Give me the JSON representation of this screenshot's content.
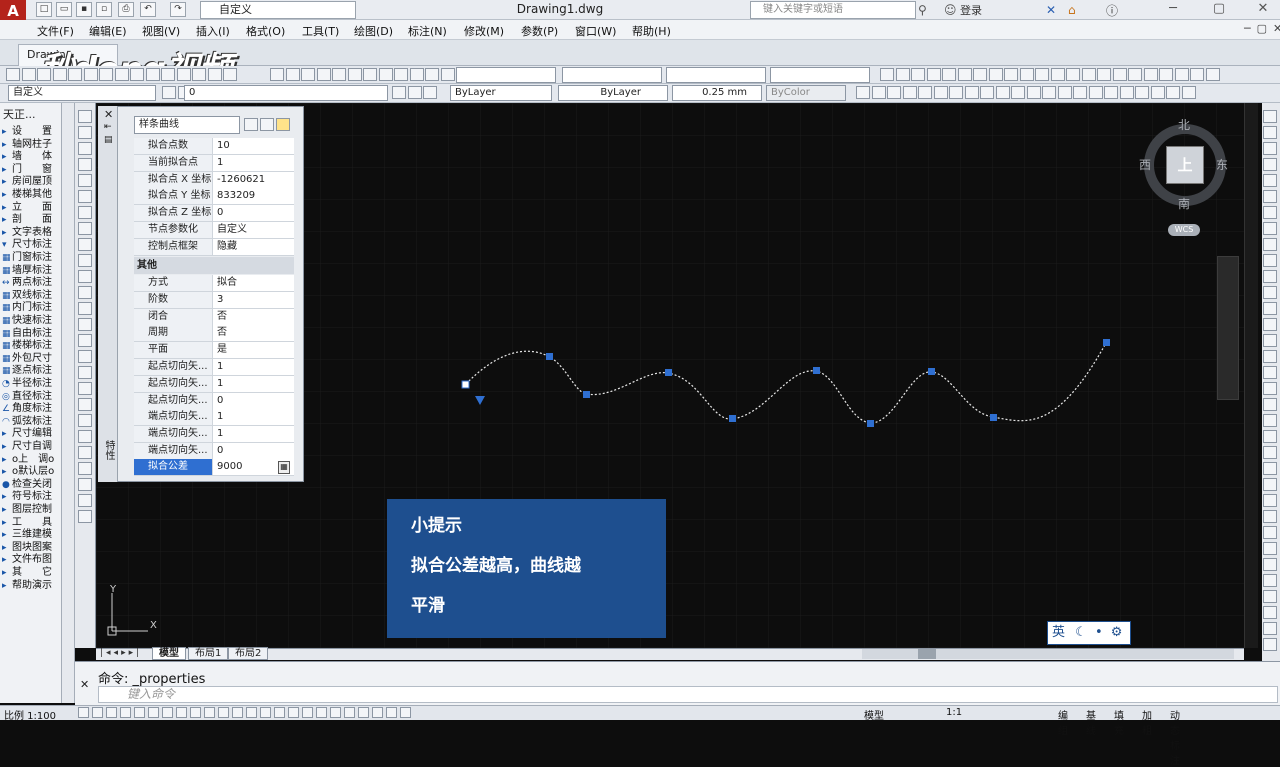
{
  "titlebar": {
    "app_logo": "A",
    "workspace": "自定义",
    "document_title": "Drawing1.dwg",
    "search_placeholder": "键入关键字或短语",
    "login": "登录",
    "win_minimize": "─",
    "win_restore": "▢",
    "win_close": "✕"
  },
  "menu": [
    "文件(F)",
    "编辑(E)",
    "视图(V)",
    "插入(I)",
    "格式(O)",
    "工具(T)",
    "绘图(D)",
    "标注(N)",
    "修改(M)",
    "参数(P)",
    "窗口(W)",
    "帮助(H)"
  ],
  "tabs": {
    "drawing_tab": "Drawing"
  },
  "watermark": "秒dong视频",
  "toolbar": {
    "workspace_select": "自定义",
    "layer_select": "0",
    "color_select": "ByLayer",
    "linetype_select": "ByLayer",
    "lineweight_select": "0.25 mm",
    "plotstyle_select": "ByColor"
  },
  "left_panel": {
    "title": "天正...",
    "items": [
      {
        "glyph": "▸",
        "label": "设　　置"
      },
      {
        "glyph": "▸",
        "label": "轴网柱子"
      },
      {
        "glyph": "▸",
        "label": "墙　　体"
      },
      {
        "glyph": "▸",
        "label": "门　　窗"
      },
      {
        "glyph": "▸",
        "label": "房间屋顶"
      },
      {
        "glyph": "▸",
        "label": "楼梯其他"
      },
      {
        "glyph": "▸",
        "label": "立　　面"
      },
      {
        "glyph": "▸",
        "label": "剖　　面"
      },
      {
        "glyph": "▸",
        "label": "文字表格"
      },
      {
        "glyph": "▾",
        "label": "尺寸标注"
      },
      {
        "glyph": "▦",
        "label": "门窗标注"
      },
      {
        "glyph": "▦",
        "label": "墙厚标注"
      },
      {
        "glyph": "↔",
        "label": "两点标注"
      },
      {
        "glyph": "▦",
        "label": "双线标注"
      },
      {
        "glyph": "▦",
        "label": "内门标注"
      },
      {
        "glyph": "▦",
        "label": "快速标注"
      },
      {
        "glyph": "▦",
        "label": "自由标注"
      },
      {
        "glyph": "▦",
        "label": "楼梯标注"
      },
      {
        "glyph": "▦",
        "label": "外包尺寸"
      },
      {
        "glyph": "▦",
        "label": "逐点标注"
      },
      {
        "glyph": "◔",
        "label": "半径标注"
      },
      {
        "glyph": "◎",
        "label": "直径标注"
      },
      {
        "glyph": "∠",
        "label": "角度标注"
      },
      {
        "glyph": "◠",
        "label": "弧弦标注"
      },
      {
        "glyph": "▸",
        "label": "尺寸编辑"
      },
      {
        "glyph": "▸",
        "label": "尺寸自调"
      },
      {
        "glyph": "▸",
        "label": "o上　调o"
      },
      {
        "glyph": "▸",
        "label": "o默认层o"
      },
      {
        "glyph": "●",
        "label": "检查关闭"
      },
      {
        "glyph": "▸",
        "label": "符号标注"
      },
      {
        "glyph": "▸",
        "label": "图层控制"
      },
      {
        "glyph": "▸",
        "label": "工　　具"
      },
      {
        "glyph": "▸",
        "label": "三维建模"
      },
      {
        "glyph": "▸",
        "label": "图块图案"
      },
      {
        "glyph": "▸",
        "label": "文件布图"
      },
      {
        "glyph": "▸",
        "label": "其　　它"
      },
      {
        "glyph": "▸",
        "label": "帮助演示"
      }
    ]
  },
  "properties": {
    "object_type": "样条曲线",
    "strip_label": "特性",
    "rows_top": [
      {
        "key": "拟合点数",
        "value": "10"
      },
      {
        "key": "当前拟合点",
        "value": "1"
      },
      {
        "key": "拟合点 X 坐标",
        "value": "-1260621"
      },
      {
        "key": "拟合点 Y 坐标",
        "value": "833209"
      },
      {
        "key": "拟合点 Z 坐标",
        "value": "0"
      },
      {
        "key": "节点参数化",
        "value": "自定义"
      },
      {
        "key": "控制点框架",
        "value": "隐藏"
      }
    ],
    "section_other": "其他",
    "rows_other": [
      {
        "key": "方式",
        "value": "拟合"
      },
      {
        "key": "阶数",
        "value": "3"
      },
      {
        "key": "闭合",
        "value": "否"
      },
      {
        "key": "周期",
        "value": "否"
      },
      {
        "key": "平面",
        "value": "是"
      },
      {
        "key": "起点切向矢...",
        "value": "1"
      },
      {
        "key": "起点切向矢...",
        "value": "1"
      },
      {
        "key": "起点切向矢...",
        "value": "0"
      },
      {
        "key": "端点切向矢...",
        "value": "1"
      },
      {
        "key": "端点切向矢...",
        "value": "1"
      },
      {
        "key": "端点切向矢...",
        "value": "0"
      }
    ],
    "selected_row": {
      "key": "拟合公差",
      "value": "9000"
    }
  },
  "tip": {
    "title": "小提示",
    "line1": "拟合公差越高，曲线越",
    "line2": "平滑"
  },
  "viewcube": {
    "north": "北",
    "south": "南",
    "east": "东",
    "west": "西",
    "top": "上",
    "wcs": "WCS"
  },
  "ucs": {
    "y": "Y",
    "x": "X"
  },
  "layout_tabs": [
    "模型",
    "布局1",
    "布局2"
  ],
  "command": {
    "history": "命令: _properties",
    "placeholder": "键入命令"
  },
  "ime": {
    "label": "英"
  },
  "statusbar": {
    "scale": "比例 1:100",
    "model": "模型",
    "annotation_scale": "1:1",
    "toggles": [
      "编组",
      "基线",
      "填充",
      "加粗",
      "动态标注"
    ]
  }
}
